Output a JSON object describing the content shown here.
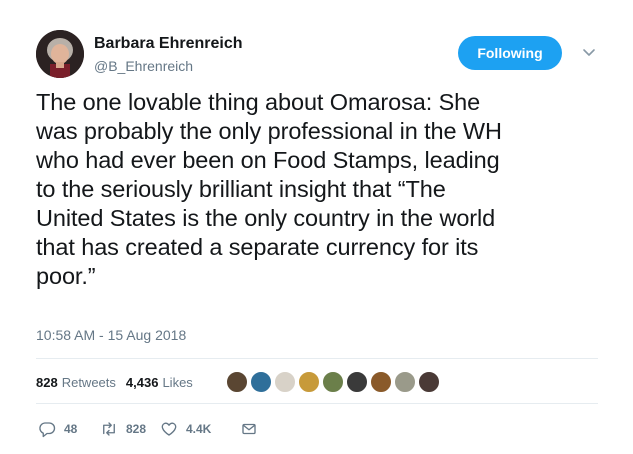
{
  "author": {
    "name": "Barbara Ehrenreich",
    "handle": "@B_Ehrenreich"
  },
  "follow_button": {
    "label": "Following"
  },
  "tweet": {
    "lines": [
      "The one lovable thing about Omarosa: She",
      "was probably the only professional in the WH",
      "who had ever been on Food Stamps, leading",
      "to the seriously brilliant insight that “The",
      "United States is the only country in the world",
      "that has created a separate currency for its",
      "poor.”"
    ],
    "timestamp": "10:58 AM - 15 Aug 2018"
  },
  "stats": {
    "retweets_count": "828",
    "retweets_label": "Retweets",
    "likes_count": "4,436",
    "likes_label": "Likes"
  },
  "liker_avatars": [
    {
      "color": "#5a4632"
    },
    {
      "color": "#2f6f9a"
    },
    {
      "color": "#d8d2c8"
    },
    {
      "color": "#c79a3a"
    },
    {
      "color": "#6b7f4a"
    },
    {
      "color": "#3a3a3a"
    },
    {
      "color": "#8a5a2a"
    },
    {
      "color": "#9a9a8a"
    },
    {
      "color": "#4a3a36"
    }
  ],
  "actions": {
    "reply_count": "48",
    "retweet_count": "828",
    "like_count": "4.4K"
  },
  "colors": {
    "accent": "#1da1f2",
    "secondary_text": "#657786"
  }
}
